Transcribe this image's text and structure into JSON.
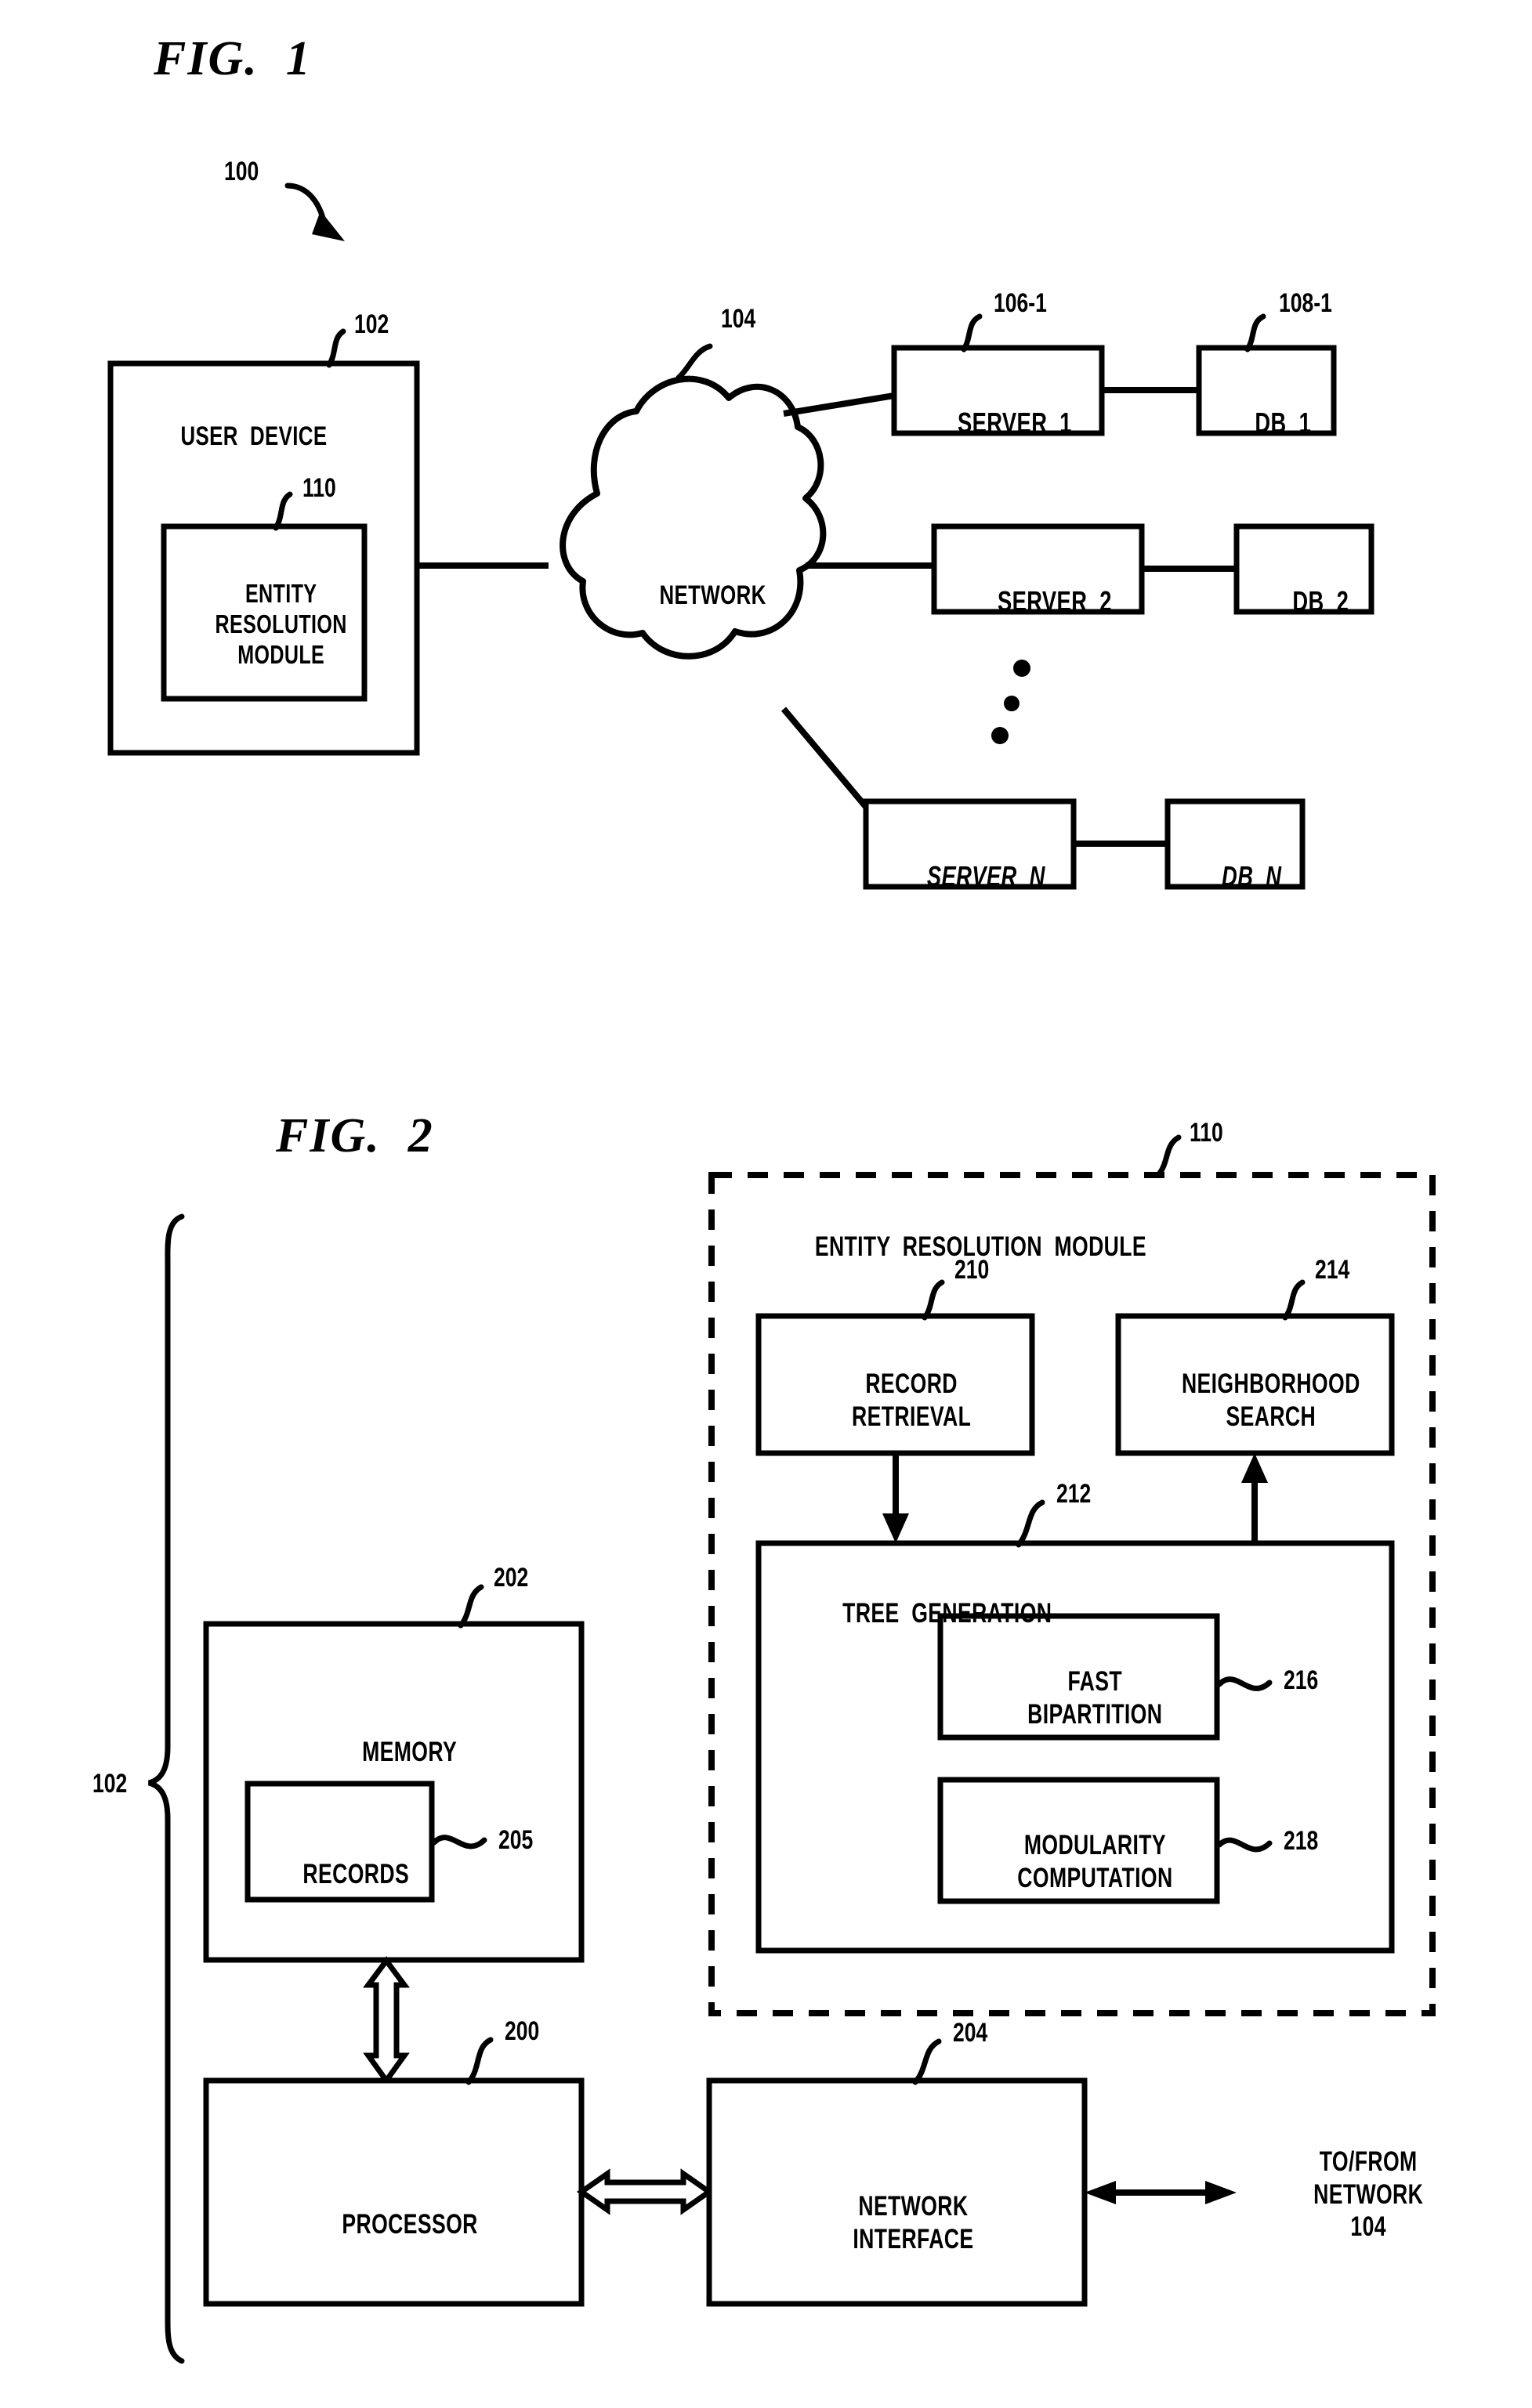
{
  "figures": [
    {
      "id": "fig1",
      "title": "FIG.  1",
      "system_ref": "100",
      "nodes": {
        "user_device": {
          "label": "USER  DEVICE",
          "ref": "102"
        },
        "entity_resolution_module": {
          "label": "ENTITY\nRESOLUTION\nMODULE",
          "ref": "110"
        },
        "network": {
          "label": "NETWORK",
          "ref": "104"
        },
        "server_1": {
          "label": "SERVER  1",
          "ref": "106-1"
        },
        "server_2": {
          "label": "SERVER  2",
          "ref": ""
        },
        "server_n": {
          "label": "SERVER  N",
          "ref": ""
        },
        "db_1": {
          "label": "DB  1",
          "ref": "108-1"
        },
        "db_2": {
          "label": "DB  2",
          "ref": ""
        },
        "db_n": {
          "label": "DB  N",
          "ref": ""
        }
      },
      "ellipsis": "vertical-dots"
    },
    {
      "id": "fig2",
      "title": "FIG.  2",
      "device_ref": "102",
      "nodes": {
        "entity_resolution_module": {
          "label": "ENTITY  RESOLUTION  MODULE",
          "ref": "110"
        },
        "record_retrieval": {
          "label": "RECORD\nRETRIEVAL",
          "ref": "210"
        },
        "neighborhood_search": {
          "label": "NEIGHBORHOOD\nSEARCH",
          "ref": "214"
        },
        "tree_generation": {
          "label": "TREE  GENERATION",
          "ref": "212"
        },
        "fast_bipartition": {
          "label": "FAST\nBIPARTITION",
          "ref": "216"
        },
        "modularity_computation": {
          "label": "MODULARITY\nCOMPUTATION",
          "ref": "218"
        },
        "memory": {
          "label": "MEMORY",
          "ref": "202"
        },
        "records": {
          "label": "RECORDS",
          "ref": "205"
        },
        "processor": {
          "label": "PROCESSOR",
          "ref": "200"
        },
        "network_interface": {
          "label": "NETWORK\nINTERFACE",
          "ref": "204"
        },
        "to_from_network": {
          "label": "TO/FROM\nNETWORK\n104"
        }
      }
    }
  ],
  "style": {
    "ink": "#000000",
    "paper": "#ffffff"
  }
}
